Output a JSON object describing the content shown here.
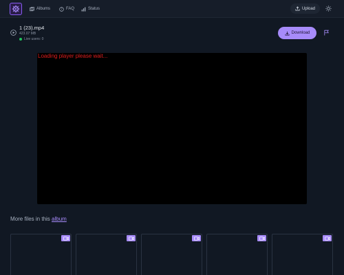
{
  "header": {
    "logo_icon": "gear-logo-icon",
    "nav": [
      {
        "label": "Albums",
        "icon": "albums-icon"
      },
      {
        "label": "FAQ",
        "icon": "help-circle-icon"
      },
      {
        "label": "Status",
        "icon": "status-bars-icon"
      }
    ],
    "upload_label": "Upload",
    "theme_icon": "sun-icon"
  },
  "file": {
    "name": "1 (23).mp4",
    "size": "423.07 MB",
    "live_users": "Live users: 0",
    "download_label": "Download"
  },
  "player": {
    "message": "Loading player please wait..."
  },
  "more_files": {
    "prefix": "More files in this",
    "link": "album"
  },
  "colors": {
    "background": "#111823",
    "accent": "#a78bfa",
    "live": "#22c55e",
    "player_message": "#e11d1d"
  }
}
